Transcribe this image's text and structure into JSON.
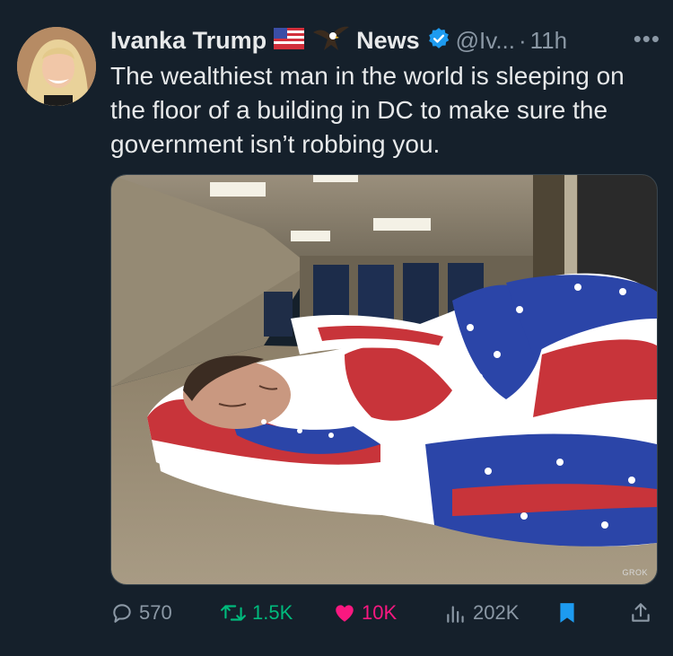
{
  "tweet": {
    "display_name": "Ivanka Trump",
    "extra_name": "News",
    "handle": "@Iv...",
    "separator": "·",
    "time": "11h",
    "more": "•••",
    "text": "The wealthiest man in the world is sleeping on the floor of a building in DC to make sure the government isn’t robbing you.",
    "watermark": "GROK"
  },
  "actions": {
    "replies": "570",
    "reposts": "1.5K",
    "likes": "10K",
    "views": "202K"
  },
  "colors": {
    "background": "#15202b",
    "secondary_text": "#8b98a5",
    "verified": "#1d9bf0",
    "repost": "#00ba7c",
    "like": "#f91880",
    "bookmark": "#1d9bf0"
  }
}
